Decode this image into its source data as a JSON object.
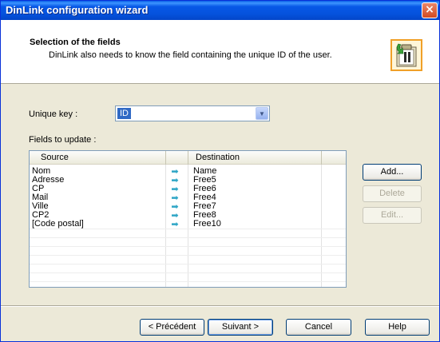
{
  "window": {
    "title": "DinLink configuration wizard",
    "close_glyph": "×"
  },
  "header": {
    "title": "Selection of the fields",
    "subtitle": "DinLink also needs to know the field containing the unique ID of the user.",
    "icon": "clipboard-icon"
  },
  "unique_key": {
    "label": "Unique key :",
    "value": "ID"
  },
  "fields": {
    "label": "Fields to update :",
    "columns": {
      "source": "Source",
      "destination": "Destination"
    },
    "arrow_glyph": "➡",
    "rows": [
      {
        "source": "Nom",
        "destination": "Name"
      },
      {
        "source": "Adresse",
        "destination": "Free5"
      },
      {
        "source": "CP",
        "destination": "Free6"
      },
      {
        "source": "Mail",
        "destination": "Free4"
      },
      {
        "source": "Ville",
        "destination": "Free7"
      },
      {
        "source": "CP2",
        "destination": "Free8"
      },
      {
        "source": "[Code postal]",
        "destination": "Free10"
      }
    ]
  },
  "side_buttons": {
    "add": "Add...",
    "delete": "Delete",
    "edit": "Edit..."
  },
  "footer": {
    "back": "< Précédent",
    "next": "Suivant >",
    "cancel": "Cancel",
    "help": "Help"
  },
  "colors": {
    "title_bar": "#0552DC",
    "selection": "#316AC5",
    "arrow": "#2FA6C6",
    "icon_border": "#F0A028"
  }
}
